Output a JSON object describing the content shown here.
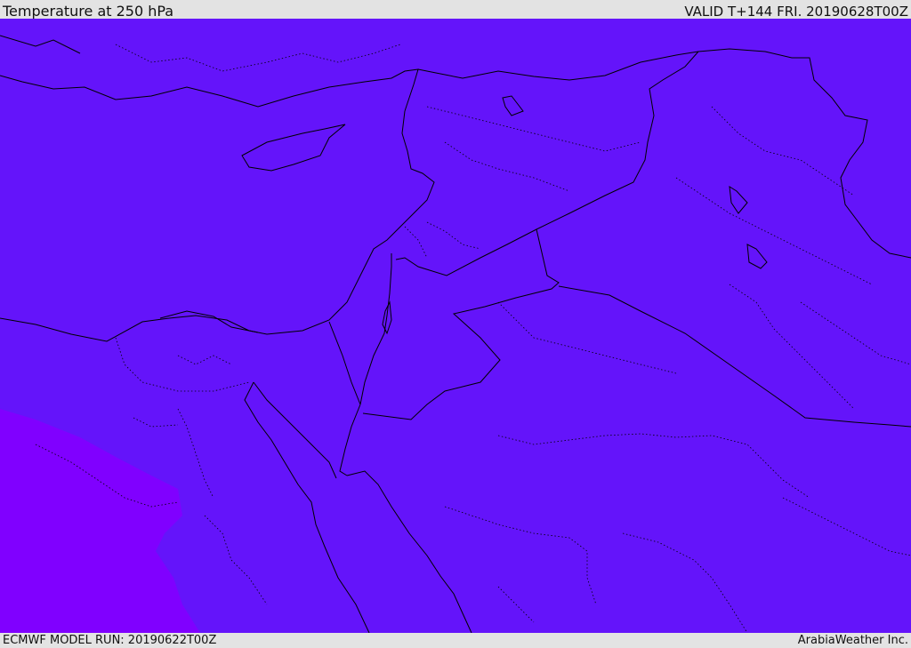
{
  "header": {
    "title": "Temperature at 250 hPa",
    "valid_label": "VALID T+144 FRI. 20190628T00Z"
  },
  "footer": {
    "model_run": "ECMWF MODEL RUN: 20190622T00Z",
    "credit": "ArabiaWeather Inc."
  },
  "map": {
    "field": "temperature_250hPa",
    "colors": {
      "background_field": "#6414fa",
      "warmer_field": "#8000ff",
      "coastline": "#000000",
      "border": "#000000",
      "inner_border": "#000000"
    }
  }
}
